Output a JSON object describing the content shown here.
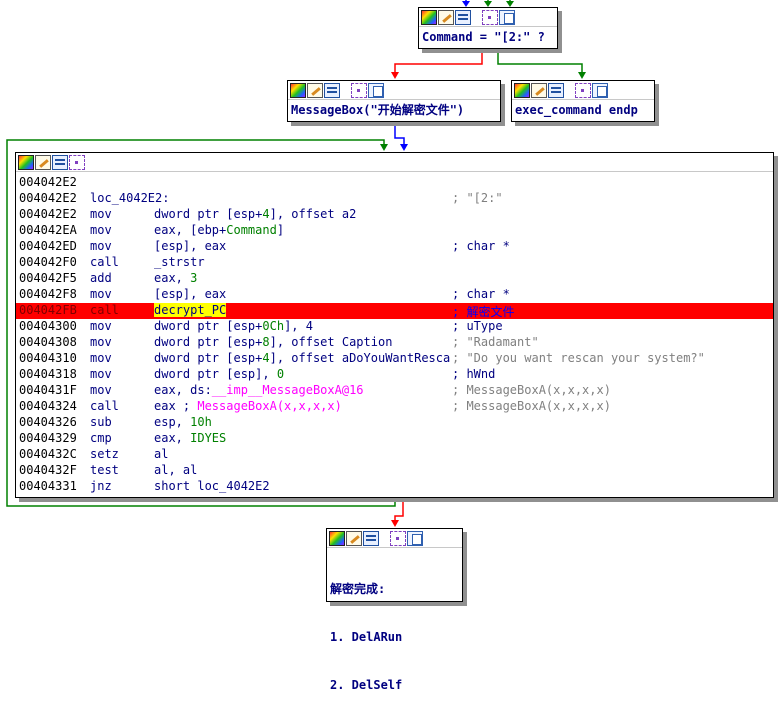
{
  "nodes": {
    "top": {
      "text": "Command = \"[2:\" ?"
    },
    "msgbox": {
      "text": "MessageBox(\"开始解密文件\")"
    },
    "exec": {
      "text": "exec_command endp"
    },
    "main": {
      "lines": [
        {
          "addr": "004042E2",
          "mnem": "",
          "op": "",
          "comment": ""
        },
        {
          "addr": "004042E2",
          "mnem": "loc_4042E2:",
          "op": "",
          "comment": "; \"[2:\""
        },
        {
          "addr": "004042E2",
          "mnem": "mov",
          "op_a": "dword ptr [esp+",
          "op_b": "4",
          "op_c": "], offset a2",
          "comment": ""
        },
        {
          "addr": "004042EA",
          "mnem": "mov",
          "op_a": "eax, [ebp+",
          "op_b": "Command",
          "op_c": "]",
          "comment": ""
        },
        {
          "addr": "004042ED",
          "mnem": "mov",
          "op": "[esp], eax",
          "comment": "; char *"
        },
        {
          "addr": "004042F0",
          "mnem": "call",
          "op": "_strstr",
          "comment": ""
        },
        {
          "addr": "004042F5",
          "mnem": "add",
          "op": "eax, 3",
          "comment": ""
        },
        {
          "addr": "004042F8",
          "mnem": "mov",
          "op": "[esp], eax",
          "comment": "; char *"
        },
        {
          "addr": "004042FB",
          "mnem": "call",
          "op": "decrypt_PC",
          "comment": "; 解密文件"
        },
        {
          "addr": "00404300",
          "mnem": "mov",
          "op_a": "dword ptr [esp+",
          "op_b": "0Ch",
          "op_c": "], 4",
          "comment": "; uType"
        },
        {
          "addr": "00404308",
          "mnem": "mov",
          "op_a": "dword ptr [esp+",
          "op_b": "8",
          "op_c": "], offset Caption",
          "comment": "; \"Radamant\""
        },
        {
          "addr": "00404310",
          "mnem": "mov",
          "op_a": "dword ptr [esp+",
          "op_b": "4",
          "op_c": "], offset aDoYouWantResca",
          "comment": "; \"Do you want rescan your system?\""
        },
        {
          "addr": "00404318",
          "mnem": "mov",
          "op_a": "dword ptr [esp], ",
          "op_b": "0",
          "op_c": "",
          "comment": "; hWnd"
        },
        {
          "addr": "0040431F",
          "mnem": "mov",
          "op_a": "eax, ds:",
          "op_b": "__imp__MessageBoxA@16",
          "op_c": "",
          "comment": "; MessageBoxA(x,x,x,x)"
        },
        {
          "addr": "00404324",
          "mnem": "call",
          "op_a": "eax ; ",
          "op_b": "MessageBoxA(x,x,x,x)",
          "op_c": "",
          "comment": "; MessageBoxA(x,x,x,x)"
        },
        {
          "addr": "00404326",
          "mnem": "sub",
          "op": "esp, 10h",
          "comment": ""
        },
        {
          "addr": "00404329",
          "mnem": "cmp",
          "op": "eax, IDYES",
          "comment": ""
        },
        {
          "addr": "0040432C",
          "mnem": "setz",
          "op": "al",
          "comment": ""
        },
        {
          "addr": "0040432F",
          "mnem": "test",
          "op": "al, al",
          "comment": ""
        },
        {
          "addr": "00404331",
          "mnem": "jnz",
          "op": "short loc_4042E2",
          "comment": ""
        }
      ]
    },
    "bottom": {
      "lines": [
        "解密完成:",
        "1. DelARun",
        "2. DelSelf"
      ]
    }
  },
  "colors": {
    "edge_false": "#ff0000",
    "edge_true": "#008000",
    "edge_uncond": "#0000ff",
    "highlight_row": "#ff0000",
    "highlight_symbol": "#ffff00"
  }
}
